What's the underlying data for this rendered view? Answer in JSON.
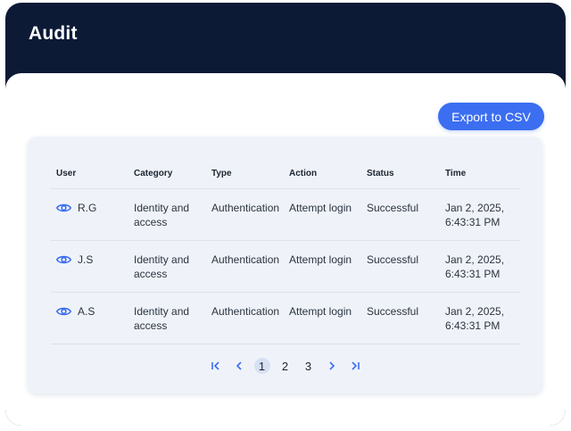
{
  "header": {
    "title": "Audit"
  },
  "toolbar": {
    "export_label": "Export to CSV"
  },
  "table": {
    "columns": [
      "User",
      "Category",
      "Type",
      "Action",
      "Status",
      "Time"
    ],
    "rows": [
      {
        "user": "R.G",
        "category": "Identity and access",
        "type": "Authentication",
        "action": "Attempt login",
        "status": "Successful",
        "time": "Jan 2, 2025, 6:43:31 PM"
      },
      {
        "user": "J.S",
        "category": "Identity and access",
        "type": "Authentication",
        "action": "Attempt login",
        "status": "Successful",
        "time": "Jan 2, 2025, 6:43:31 PM"
      },
      {
        "user": "A.S",
        "category": "Identity and access",
        "type": "Authentication",
        "action": "Attempt login",
        "status": "Successful",
        "time": "Jan 2, 2025, 6:43:31 PM"
      }
    ]
  },
  "pagination": {
    "pages": [
      "1",
      "2",
      "3"
    ],
    "current": "1"
  },
  "icons": {
    "row_action": "eye-icon",
    "first": "first-page-icon",
    "prev": "chevron-left-icon",
    "next": "chevron-right-icon",
    "last": "last-page-icon"
  },
  "colors": {
    "header_bg": "#0c1a36",
    "accent": "#3b6ef0",
    "card_bg": "#eff3f9",
    "active_page_bg": "#d7e1f4"
  }
}
